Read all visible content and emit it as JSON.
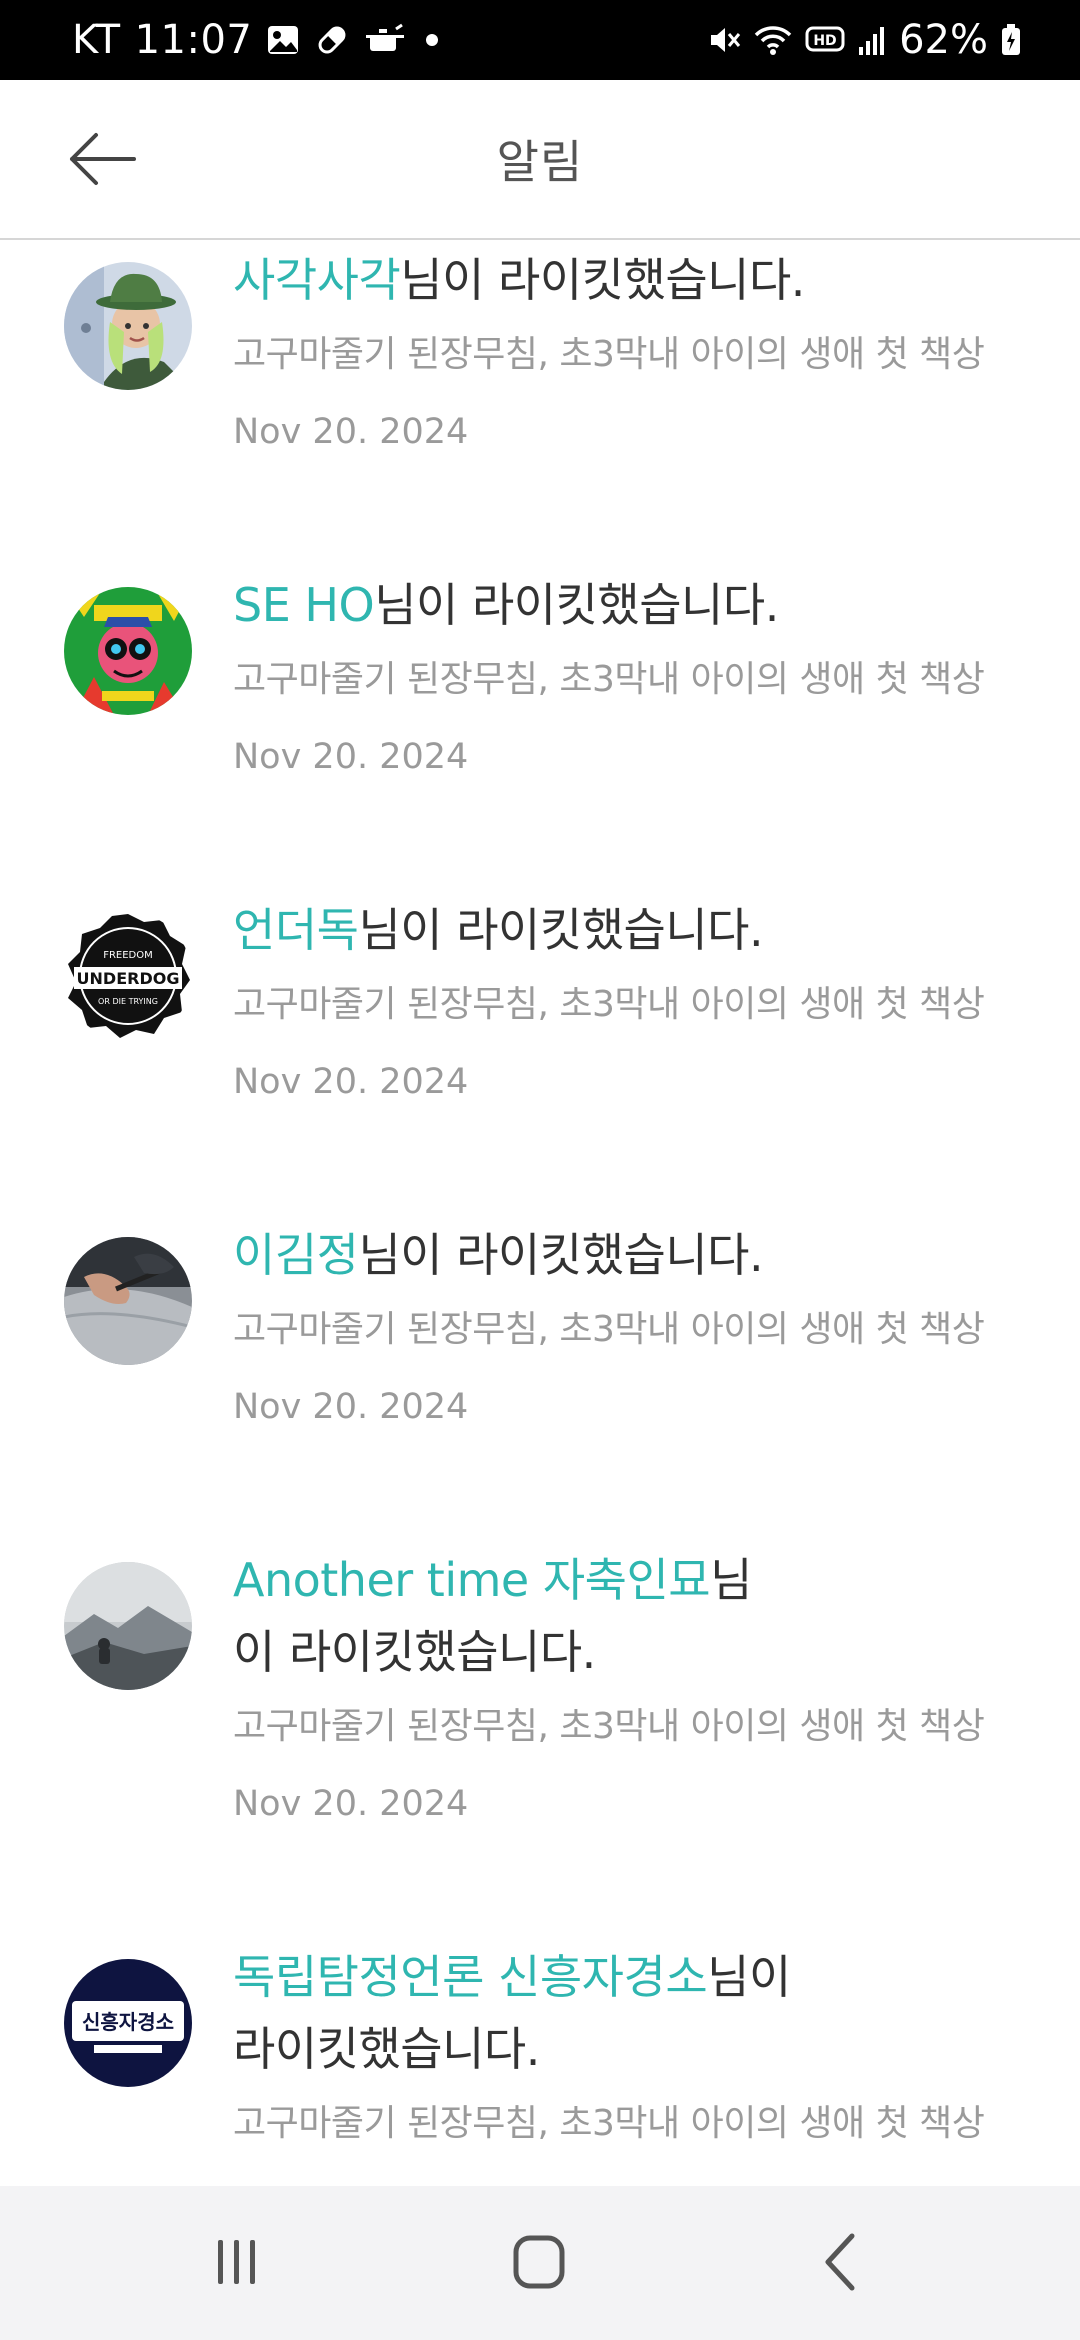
{
  "status_bar": {
    "carrier": "KT",
    "time": "11:07",
    "battery_percent": "62%",
    "icons_left": [
      "gallery-icon",
      "pill-icon",
      "pot-icon",
      "dot-icon"
    ],
    "icons_right": [
      "mute-icon",
      "wifi-icon",
      "hd-voice-icon",
      "signal-icon",
      "battery-icon"
    ]
  },
  "header": {
    "title": "알림",
    "back_icon": "arrow-left-icon"
  },
  "notifications": [
    {
      "user": "사각사각",
      "action_suffix": "님이 라이킷했습니다.",
      "post_title": "고구마줄기 된장무침, 초3막내 아이의 생애 첫 책상",
      "date": "Nov 20. 2024",
      "avatar": "avatar-cartoon-girl"
    },
    {
      "user": "SE HO",
      "action_suffix": "님이 라이킷했습니다.",
      "post_title": "고구마줄기 된장무침, 초3막내 아이의 생애 첫 책상",
      "date": "Nov 20. 2024",
      "avatar": "avatar-rock-illustration"
    },
    {
      "user": "언더독",
      "action_suffix": "님이 라이킷했습니다.",
      "post_title": "고구마줄기 된장무침, 초3막내 아이의 생애 첫 책상",
      "date": "Nov 20. 2024",
      "avatar": "avatar-underdog-badge",
      "avatar_text": {
        "top": "FREEDOM",
        "middle": "UNDERDOG",
        "bottom": "OR DIE TRYING"
      }
    },
    {
      "user": "이김정",
      "action_suffix": "님이 라이킷했습니다.",
      "post_title": "고구마줄기 된장무침, 초3막내 아이의 생애 첫 책상",
      "date": "Nov 20. 2024",
      "avatar": "avatar-hand-writing-photo"
    },
    {
      "user": "Another time 자축인묘",
      "action_suffix": "님이 라이킷했습니다.",
      "post_title": "고구마줄기 된장무침, 초3막내 아이의 생애 첫 책상",
      "date": "Nov 20. 2024",
      "avatar": "avatar-mountain-photo"
    },
    {
      "user": "독립탐정언론 신흥자경소",
      "action_suffix": "님이 라이킷했습니다.",
      "post_title": "고구마줄기 된장무침, 초3막내 아이의 생애 첫 책상",
      "date": "",
      "avatar": "avatar-sign-logo",
      "avatar_text": {
        "main": "신흥자경소"
      }
    }
  ],
  "nav_bar": {
    "recents_icon": "recents-icon",
    "home_icon": "home-icon",
    "back_icon": "back-chevron-icon"
  },
  "colors": {
    "accent": "#2fb6b0",
    "body_text": "#333333",
    "secondary_text": "#9a9a9a",
    "divider": "#d6d6d6",
    "status_bar_bg": "#000000",
    "nav_bar_bg": "#f3f3f5"
  }
}
